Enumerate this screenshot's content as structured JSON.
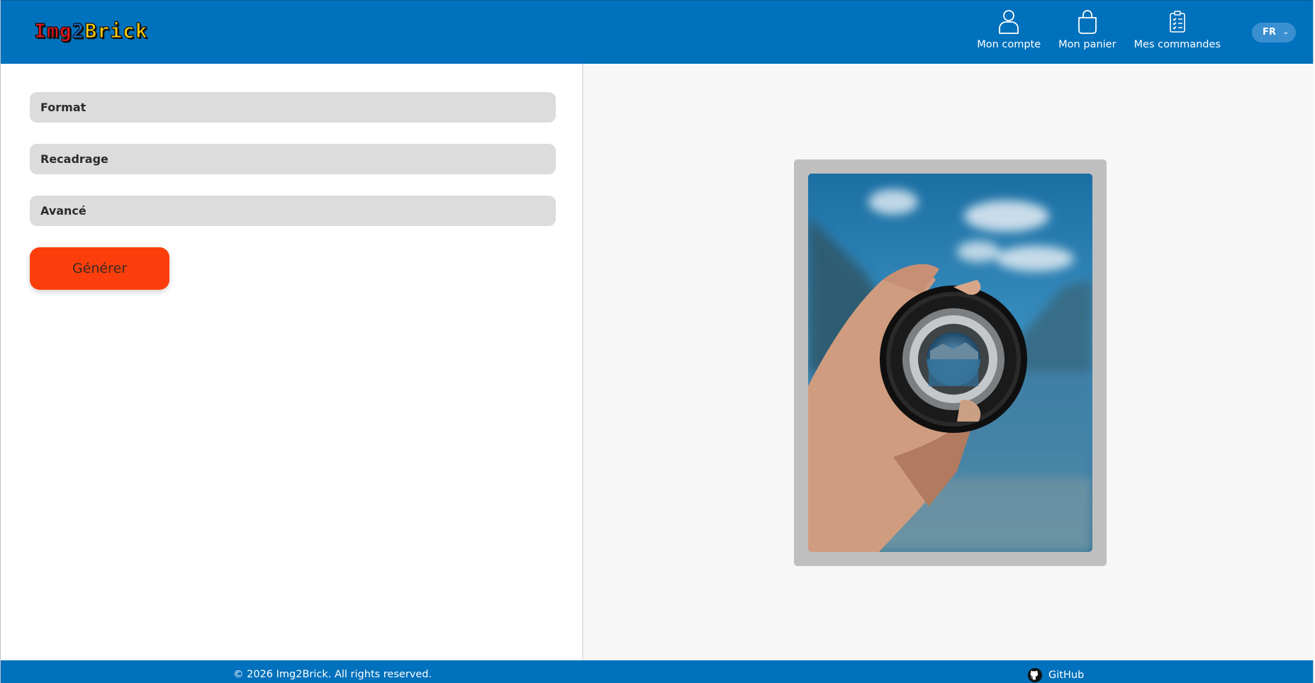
{
  "header": {
    "logo": {
      "part1": "Img",
      "part2": "2",
      "part3": "Brick"
    },
    "nav": [
      {
        "label": "Mon compte",
        "icon": "user-icon"
      },
      {
        "label": "Mon panier",
        "icon": "shopping-bag-icon"
      },
      {
        "label": "Mes commandes",
        "icon": "clipboard-list-icon"
      }
    ],
    "language": "FR"
  },
  "options": {
    "sections": [
      "Format",
      "Recadrage",
      "Avancé"
    ],
    "generate_label": "Générer"
  },
  "footer": {
    "copyright": "© 2026 Img2Brick. All rights reserved.",
    "github_label": "GitHub"
  },
  "colors": {
    "header_bg": "#0071bc",
    "generate_button": "#fb3e0b",
    "section_bg": "#dcdcdc",
    "preview_bg": "#f7f7f7"
  }
}
